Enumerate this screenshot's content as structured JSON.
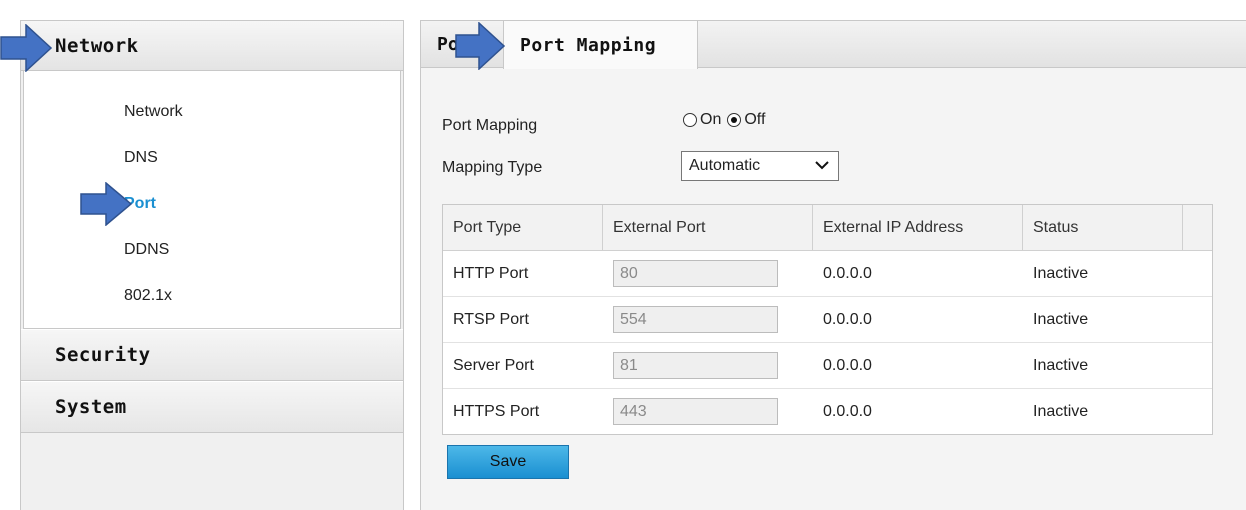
{
  "sidebar": {
    "header": "Network",
    "items": [
      {
        "label": "Network"
      },
      {
        "label": "DNS"
      },
      {
        "label": "Port"
      },
      {
        "label": "DDNS"
      },
      {
        "label": "802.1x"
      }
    ],
    "sections": [
      {
        "label": "Security"
      },
      {
        "label": "System"
      }
    ]
  },
  "tabs": [
    {
      "label": "Po"
    },
    {
      "label": "Port Mapping"
    }
  ],
  "form": {
    "port_mapping_label": "Port Mapping",
    "on_label": "On",
    "off_label": "Off",
    "mapping_type_label": "Mapping Type",
    "mapping_type_value": "Automatic"
  },
  "table": {
    "headers": [
      "Port Type",
      "External Port",
      "External IP Address",
      "Status"
    ],
    "rows": [
      {
        "port_type": "HTTP Port",
        "external_port": "80",
        "ip": "0.0.0.0",
        "status": "Inactive"
      },
      {
        "port_type": "RTSP Port",
        "external_port": "554",
        "ip": "0.0.0.0",
        "status": "Inactive"
      },
      {
        "port_type": "Server Port",
        "external_port": "81",
        "ip": "0.0.0.0",
        "status": "Inactive"
      },
      {
        "port_type": "HTTPS Port",
        "external_port": "443",
        "ip": "0.0.0.0",
        "status": "Inactive"
      }
    ]
  },
  "save_label": "Save",
  "colors": {
    "accent": "#1a8fd1",
    "arrow": "#4472c4"
  }
}
